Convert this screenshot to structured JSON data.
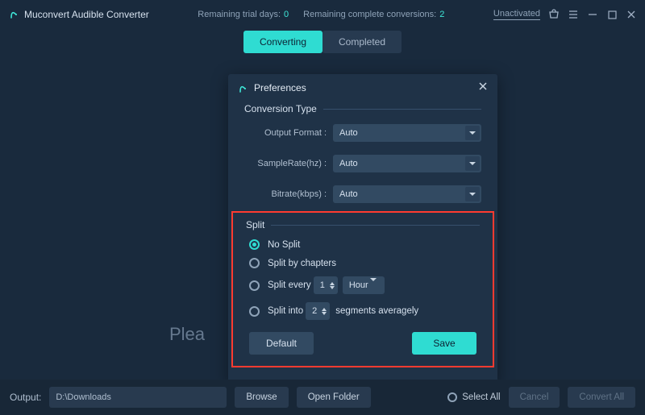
{
  "app": {
    "title": "Muconvert Audible Converter",
    "trial_days_label": "Remaining trial days:",
    "trial_days": "0",
    "conv_left_label": "Remaining complete conversions:",
    "conv_left": "2",
    "unactivated": "Unactivated"
  },
  "tabs": {
    "converting": "Converting",
    "completed": "Completed",
    "active": "converting"
  },
  "background_text": "Plea",
  "modal": {
    "title": "Preferences",
    "legend1": "Conversion Type",
    "fields": {
      "format_label": "Output Format :",
      "format_value": "Auto",
      "sample_label": "SampleRate(hz) :",
      "sample_value": "Auto",
      "bitrate_label": "Bitrate(kbps) :",
      "bitrate_value": "Auto"
    },
    "legend2": "Split",
    "split": {
      "no_split": "No Split",
      "by_chapters": "Split by chapters",
      "every_pre": "Split every",
      "every_val": "1",
      "every_unit": "Hour",
      "into_pre": "Split into",
      "into_val": "2",
      "into_post": "segments averagely",
      "selected": "no_split"
    },
    "btn_default": "Default",
    "btn_save": "Save"
  },
  "bottom": {
    "out_label": "Output:",
    "out_path": "D:\\Downloads",
    "browse": "Browse",
    "open_folder": "Open Folder",
    "select_all": "Select All",
    "cancel": "Cancel",
    "convert_all": "Convert All"
  }
}
